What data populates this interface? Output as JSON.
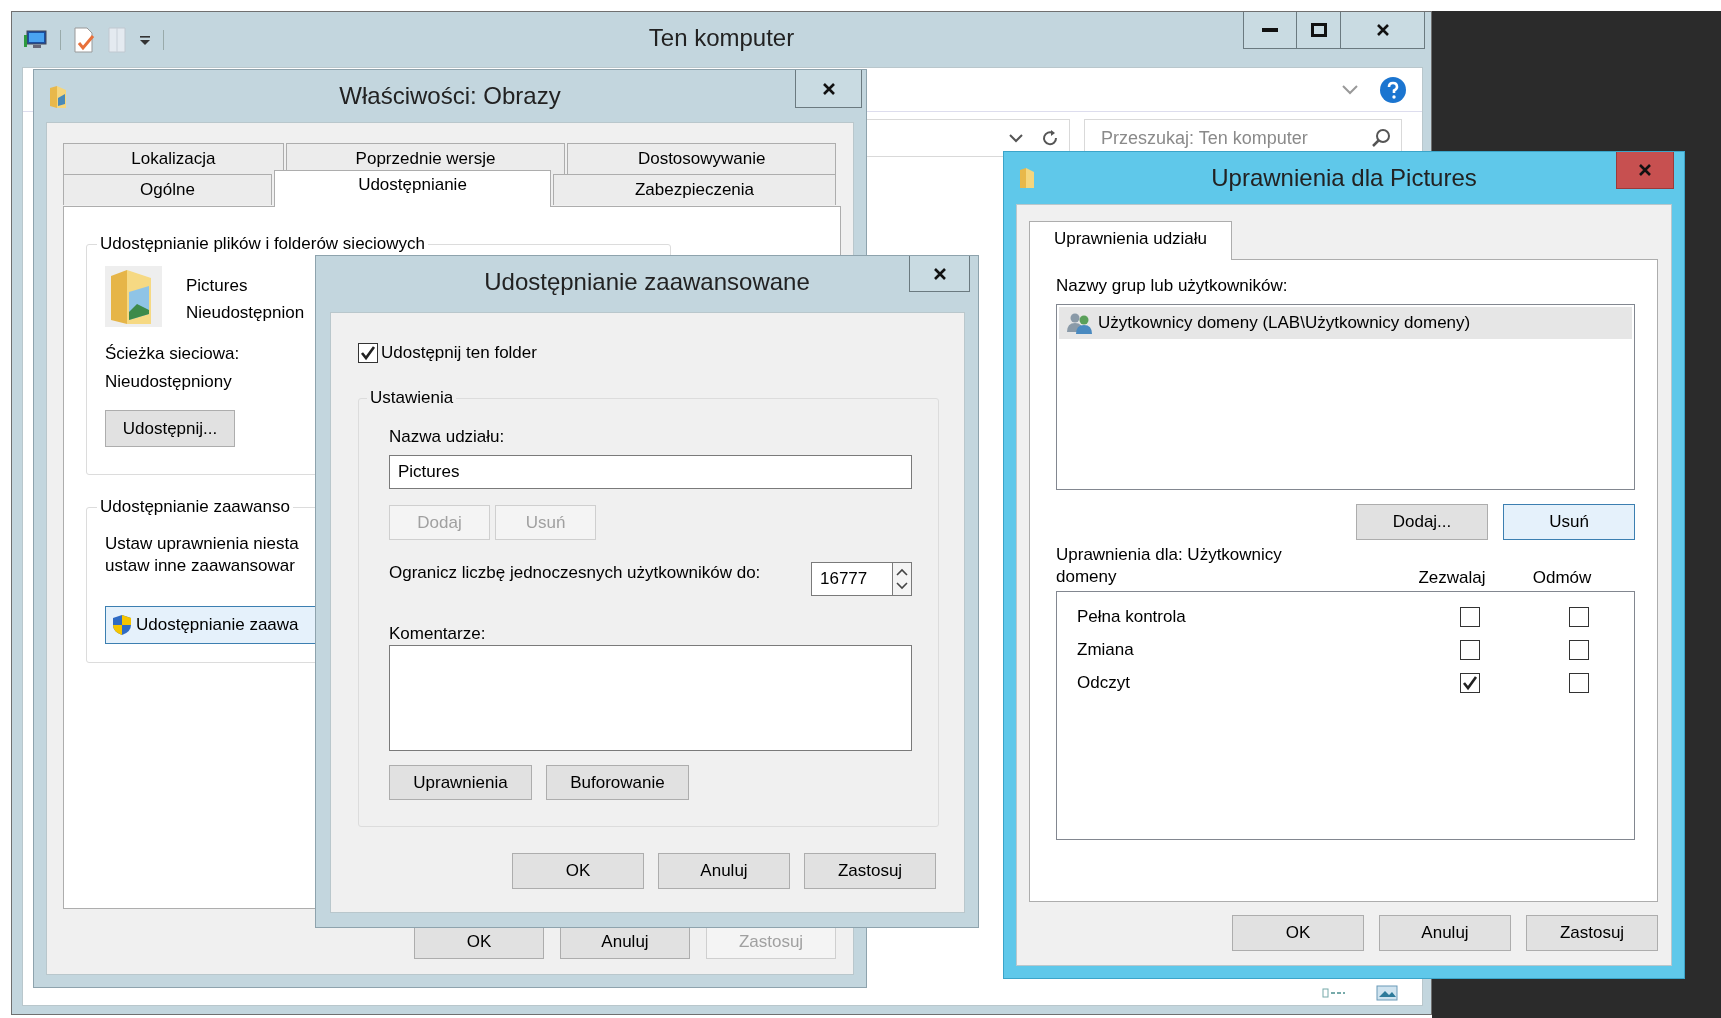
{
  "explorer": {
    "title": "Ten komputer",
    "active": false,
    "search": {
      "placeholder": "Przeszukaj: Ten komputer"
    }
  },
  "properties_dialog": {
    "title": "Właściwości: Obrazy",
    "active": false,
    "tab_rows": [
      [
        {
          "label": "Lokalizacja",
          "selected": false
        },
        {
          "label": "Poprzednie wersje",
          "selected": false
        },
        {
          "label": "Dostosowywanie",
          "selected": false
        }
      ],
      [
        {
          "label": "Ogólne",
          "selected": false
        },
        {
          "label": "Udostępnianie",
          "selected": true
        },
        {
          "label": "Zabezpieczenia",
          "selected": false
        }
      ]
    ],
    "network_sharing": {
      "heading": "Udostępnianie plików i folderów sieciowych",
      "folder_name": "Pictures",
      "folder_status": "Nieudostępnion",
      "path_label": "Ścieżka sieciowa:",
      "path_value": "Nieudostępniony",
      "share_button": "Udostępnij..."
    },
    "advanced_sharing": {
      "heading": "Udostępnianie zaawanso",
      "description_lines": [
        "Ustaw uprawnienia niesta",
        "ustaw inne zaawansowar"
      ],
      "button": {
        "label": "Udostępnianie zaawa",
        "focused": true
      }
    },
    "buttons": [
      {
        "label": "OK",
        "disabled": false
      },
      {
        "label": "Anuluj",
        "disabled": false
      },
      {
        "label": "Zastosuj",
        "disabled": true
      }
    ]
  },
  "advanced_dialog": {
    "title": "Udostępnianie zaawansowane",
    "active": false,
    "share_checkbox": {
      "label": "Udostępnij ten folder",
      "checked": true
    },
    "settings": {
      "heading": "Ustawienia",
      "share_name_label": "Nazwa udziału:",
      "share_name_value": "Pictures",
      "name_buttons": [
        {
          "label": "Dodaj",
          "disabled": true
        },
        {
          "label": "Usuń",
          "disabled": true
        }
      ],
      "limit_label": "Ogranicz liczbę jednoczesnych użytkowników do:",
      "limit_value": "16777",
      "comments_label": "Komentarze:",
      "extra_buttons": [
        {
          "label": "Uprawnienia",
          "disabled": false
        },
        {
          "label": "Buforowanie",
          "disabled": false
        }
      ]
    },
    "buttons": [
      {
        "label": "OK",
        "disabled": false
      },
      {
        "label": "Anuluj",
        "disabled": false
      },
      {
        "label": "Zastosuj",
        "disabled": false
      }
    ]
  },
  "permissions_dialog": {
    "title": "Uprawnienia dla Pictures",
    "active": true,
    "tabs": [
      {
        "label": "Uprawnienia udziału",
        "selected": true
      }
    ],
    "groups_label": "Nazwy grup lub użytkowników:",
    "principals": [
      {
        "name": "Użytkownicy domeny (LAB\\Użytkownicy domeny)",
        "selected": true
      }
    ],
    "principal_buttons": [
      {
        "label": "Dodaj...",
        "focused": false
      },
      {
        "label": "Usuń",
        "focused": true
      }
    ],
    "permissions_label": "Uprawnienia dla: Użytkownicy domeny",
    "columns": [
      "Zezwalaj",
      "Odmów"
    ],
    "permissions": [
      {
        "name": "Pełna kontrola",
        "allow": false,
        "deny": false
      },
      {
        "name": "Zmiana",
        "allow": false,
        "deny": false
      },
      {
        "name": "Odczyt",
        "allow": true,
        "deny": false
      }
    ],
    "buttons": [
      {
        "label": "OK",
        "disabled": false
      },
      {
        "label": "Anuluj",
        "disabled": false
      },
      {
        "label": "Zastosuj",
        "disabled": false
      }
    ]
  }
}
